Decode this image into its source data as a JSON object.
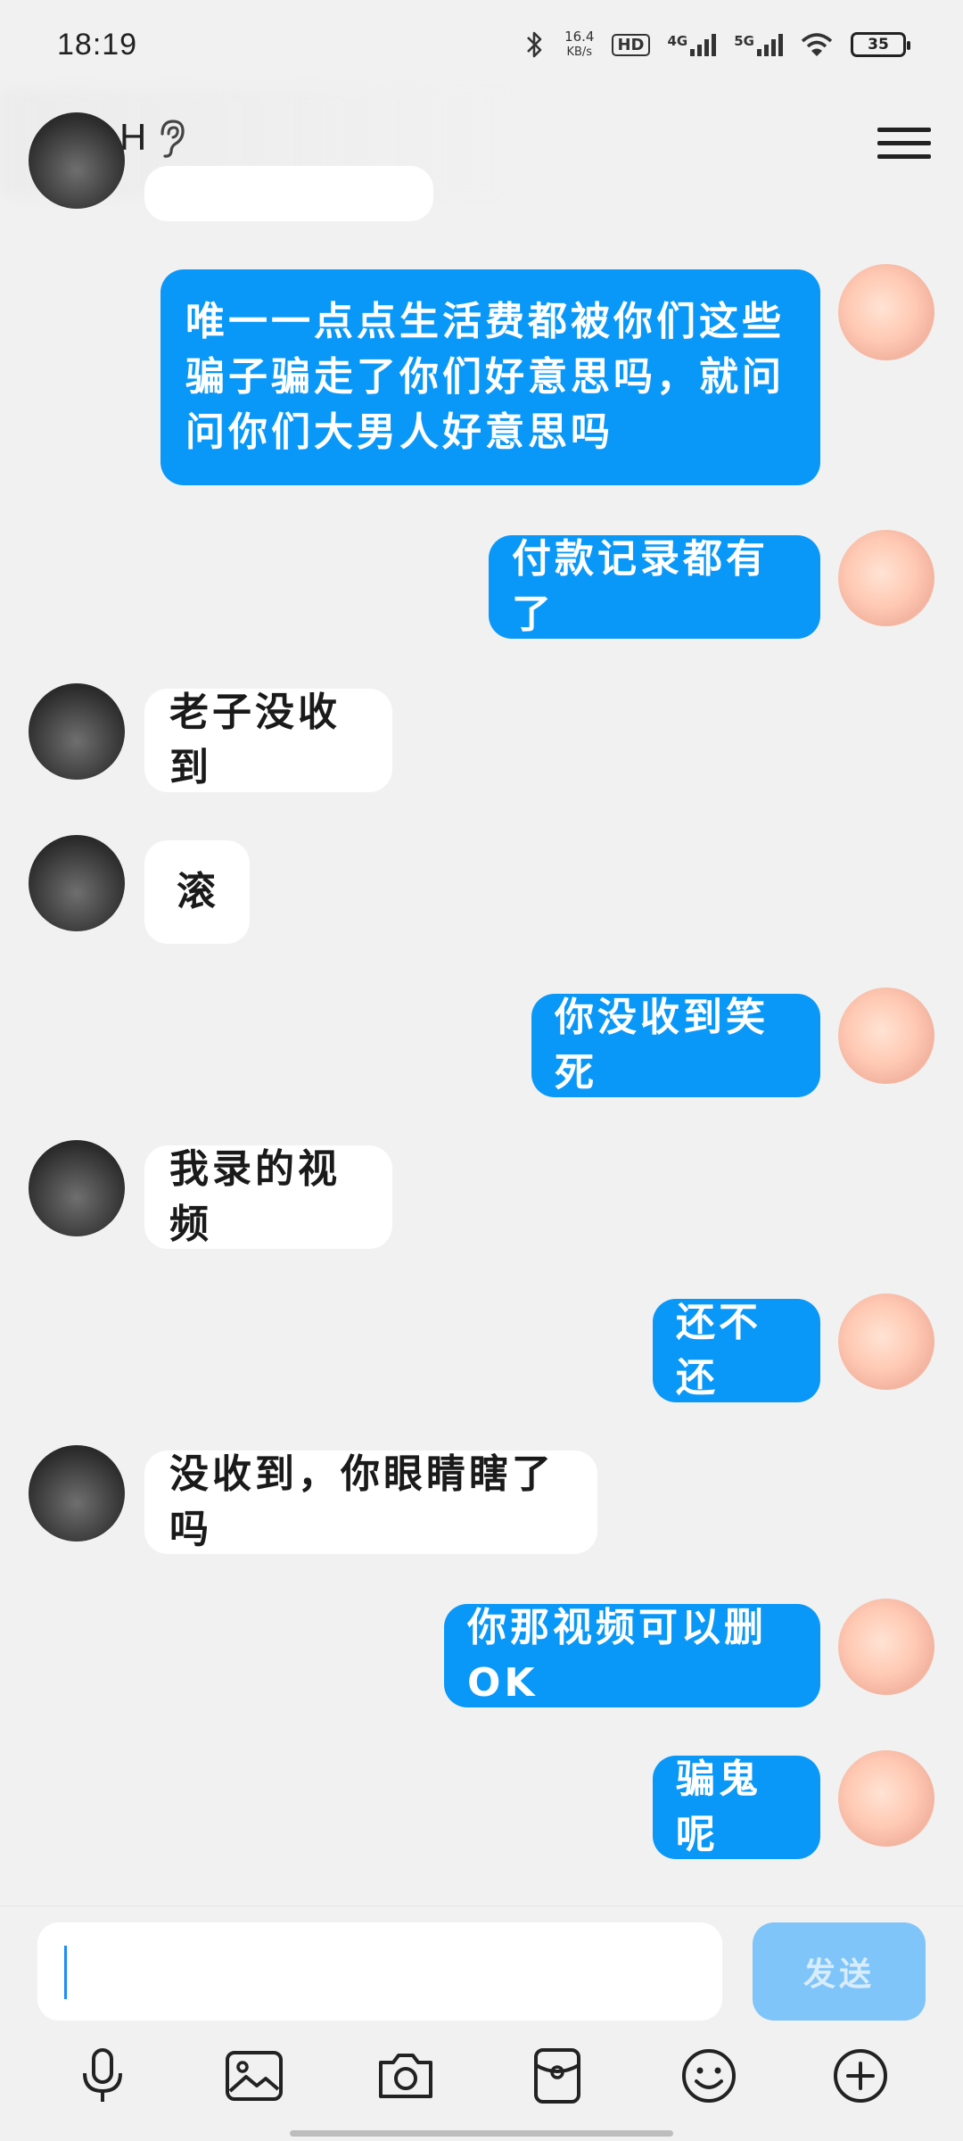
{
  "status_bar": {
    "time": "18:19",
    "net_speed": "16.4",
    "net_speed_unit": "KB/s",
    "hd_label": "HD",
    "signal_1_label": "4G",
    "signal_2_label": "5G",
    "battery": "35"
  },
  "header": {
    "contact_name": "H"
  },
  "messages": [
    {
      "from": "me",
      "text": "唯一一点点生活费都被你们这些骗子骗走了你们好意思吗，就问问你们大男人好意思吗"
    },
    {
      "from": "me",
      "text": "付款记录都有了"
    },
    {
      "from": "other",
      "text": "老子没收到"
    },
    {
      "from": "other",
      "text": "滚"
    },
    {
      "from": "me",
      "text": "你没收到笑死"
    },
    {
      "from": "other",
      "text": "我录的视频"
    },
    {
      "from": "me",
      "text": "还不还"
    },
    {
      "from": "other",
      "text": "没收到，你眼睛瞎了吗"
    },
    {
      "from": "me",
      "text": "你那视频可以删OK"
    },
    {
      "from": "me",
      "text": "骗鬼呢"
    }
  ],
  "input": {
    "value": "",
    "send_label": "发送"
  },
  "toolbar": {
    "items": [
      "microphone-icon",
      "image-icon",
      "camera-icon",
      "red-packet-icon",
      "emoji-icon",
      "plus-icon"
    ]
  },
  "colors": {
    "outgoing_bubble": "#0a98f8",
    "incoming_bubble": "#ffffff",
    "background": "#f1f1f1",
    "send_button": "#80c5f9"
  }
}
